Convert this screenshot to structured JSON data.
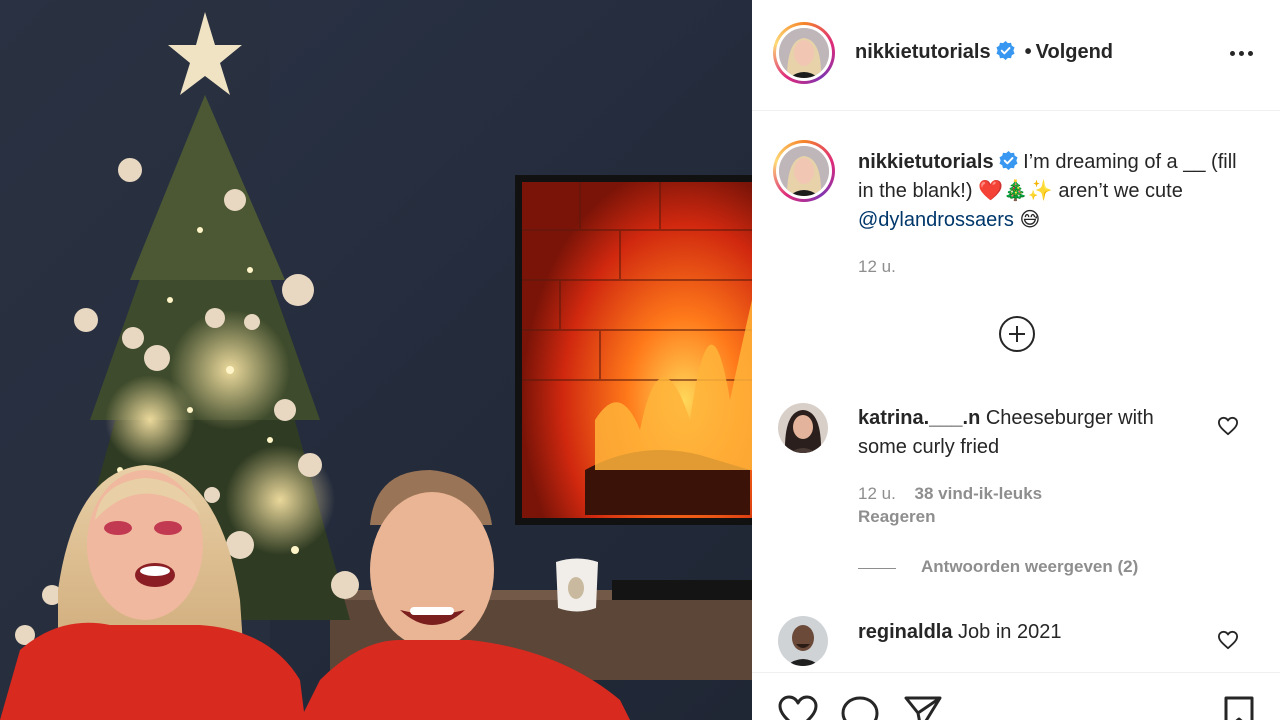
{
  "post": {
    "author": "nikkietutorials",
    "follow_status": "Volgend",
    "separator": "•",
    "caption_text": "I’m dreaming of a __ (fill in the blank!) ❤️🎄✨ aren’t we cute",
    "caption_mention": "@dylandrossaers",
    "caption_emoji": "😅",
    "time": "12 u."
  },
  "comments": [
    {
      "username": "katrina.___.n",
      "text": "Cheeseburger with some curly fried",
      "time": "12 u.",
      "likes": "38 vind-ik-leuks",
      "reply_label": "Reageren",
      "view_replies": "Antwoorden weergeven (2)"
    },
    {
      "username": "reginaldla",
      "text": "Job in 2021"
    }
  ],
  "icons": {
    "verified": "verified-badge-icon",
    "more": "more-options-icon",
    "add": "add-comment-plus-icon",
    "like": "heart-icon",
    "comment": "comment-icon",
    "share": "share-icon",
    "save": "bookmark-icon"
  },
  "colors": {
    "verified": "#3897f0",
    "mention": "#00376b",
    "muted": "#8e8e8e"
  }
}
